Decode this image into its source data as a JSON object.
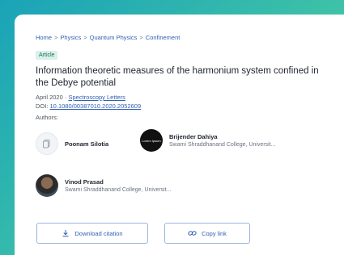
{
  "breadcrumb": {
    "items": [
      "Home",
      "Physics",
      "Quantum Physics",
      "Confinement"
    ],
    "separator": ">"
  },
  "article": {
    "badge": "Article",
    "title": "Information theoretic measures of the harmonium system confined in the Debye potential",
    "date": "April 2020",
    "journal": "Spectroscopy Letters",
    "doi_label": "DOI:",
    "doi": "10.1080/00387010.2020.2052609",
    "authors_label": "Authors:"
  },
  "authors": [
    {
      "name": "Poonam Silotia",
      "affiliation": "",
      "avatar": "placeholder-icon"
    },
    {
      "name": "Brijender Dahiya",
      "affiliation": "Swami Shraddhanand College, Universit...",
      "avatar": "logo",
      "avatar_text": "Lorem Ipsum"
    },
    {
      "name": "Vinod Prasad",
      "affiliation": "Swami Shraddhanand College, Universit...",
      "avatar": "photo"
    }
  ],
  "actions": {
    "download_label": "Download citation",
    "copy_label": "Copy link"
  },
  "colors": {
    "background_gradient": [
      "#1aa3b8",
      "#5fd49a"
    ],
    "link": "#2f5fb3",
    "badge_bg": "#d9f1ea"
  }
}
